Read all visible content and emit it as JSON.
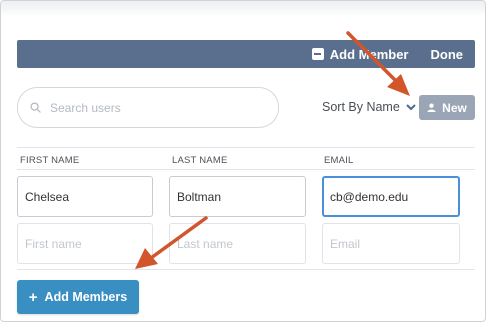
{
  "header": {
    "add_member_label": "Add Member",
    "done_label": "Done"
  },
  "search": {
    "placeholder": "Search users",
    "value": ""
  },
  "sort": {
    "label": "Sort By Name"
  },
  "new_button": {
    "label": "New"
  },
  "table": {
    "columns": [
      "FIRST NAME",
      "LAST NAME",
      "EMAIL"
    ],
    "rows": [
      {
        "first_name": "Chelsea",
        "last_name": "Boltman",
        "email": "cb@demo.edu"
      }
    ],
    "new_row_placeholders": {
      "first_name": "First name",
      "last_name": "Last name",
      "email": "Email"
    }
  },
  "add_members_button": {
    "label": "Add Members"
  },
  "colors": {
    "header_bar": "#5a6f8e",
    "new_button": "#9aa6b5",
    "add_members_button": "#3a8fc2",
    "focus_border": "#4a90d9",
    "annotation_arrow": "#d2552b"
  },
  "icons": {
    "header_add": "minus-square-icon",
    "search": "search-icon",
    "sort": "chevron-down-icon",
    "new": "user-icon",
    "add_members": "plus-icon"
  }
}
